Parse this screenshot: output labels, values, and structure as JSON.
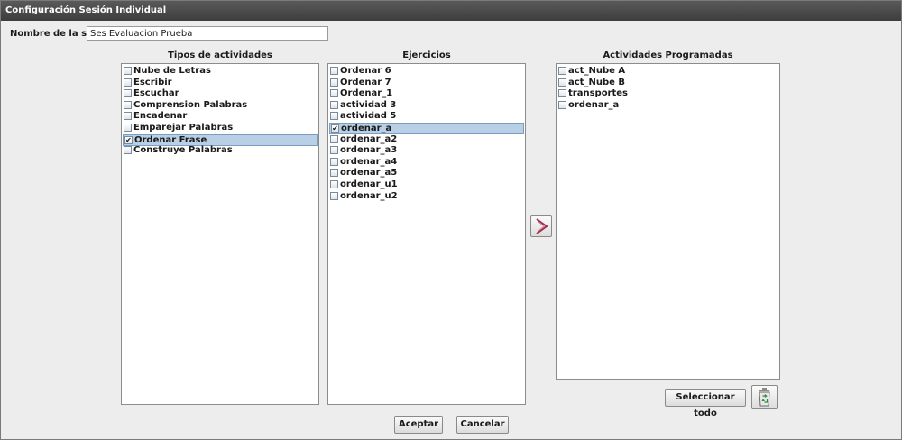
{
  "window": {
    "title": "Configuración Sesión Individual"
  },
  "session": {
    "label": "Nombre de la sesión",
    "value": "Ses Evaluacion Prueba"
  },
  "tipos": {
    "header": "Tipos de actividades",
    "items": [
      {
        "label": "Nube de Letras",
        "checked": false
      },
      {
        "label": "Escribir",
        "checked": false
      },
      {
        "label": "Escuchar",
        "checked": false
      },
      {
        "label": "Comprension Palabras",
        "checked": false
      },
      {
        "label": "Encadenar",
        "checked": false
      },
      {
        "label": "Emparejar Palabras",
        "checked": false
      },
      {
        "label": "Ordenar Frase",
        "checked": true,
        "selected": true
      },
      {
        "label": "Construye Palabras",
        "checked": false
      }
    ]
  },
  "ejercicios": {
    "header": "Ejercicios",
    "items": [
      {
        "label": "Ordenar 6",
        "checked": false
      },
      {
        "label": "Ordenar 7",
        "checked": false
      },
      {
        "label": "Ordenar_1",
        "checked": false
      },
      {
        "label": "actividad 3",
        "checked": false
      },
      {
        "label": "actividad 5",
        "checked": false
      },
      {
        "label": "ordenar_a",
        "checked": true,
        "selected": true
      },
      {
        "label": "ordenar_a2",
        "checked": false
      },
      {
        "label": "ordenar_a3",
        "checked": false
      },
      {
        "label": "ordenar_a4",
        "checked": false
      },
      {
        "label": "ordenar_a5",
        "checked": false
      },
      {
        "label": "ordenar_u1",
        "checked": false
      },
      {
        "label": "ordenar_u2",
        "checked": false
      }
    ]
  },
  "programadas": {
    "header": "Actividades Programadas",
    "items": [
      {
        "label": "act_Nube A",
        "checked": false
      },
      {
        "label": "act_Nube B",
        "checked": false
      },
      {
        "label": "transportes",
        "checked": false
      },
      {
        "label": "ordenar_a",
        "checked": false
      }
    ]
  },
  "buttons": {
    "select_all": "Seleccionar todo",
    "accept": "Aceptar",
    "cancel": "Cancelar"
  },
  "icons": {
    "add": "chevron-right-icon",
    "recycle": "recycle-bin-icon"
  },
  "colors": {
    "selection": "#b8cfe5",
    "titlebar": "#474747",
    "arrow": "#a0304a",
    "recycle": "#2e8b3a"
  }
}
